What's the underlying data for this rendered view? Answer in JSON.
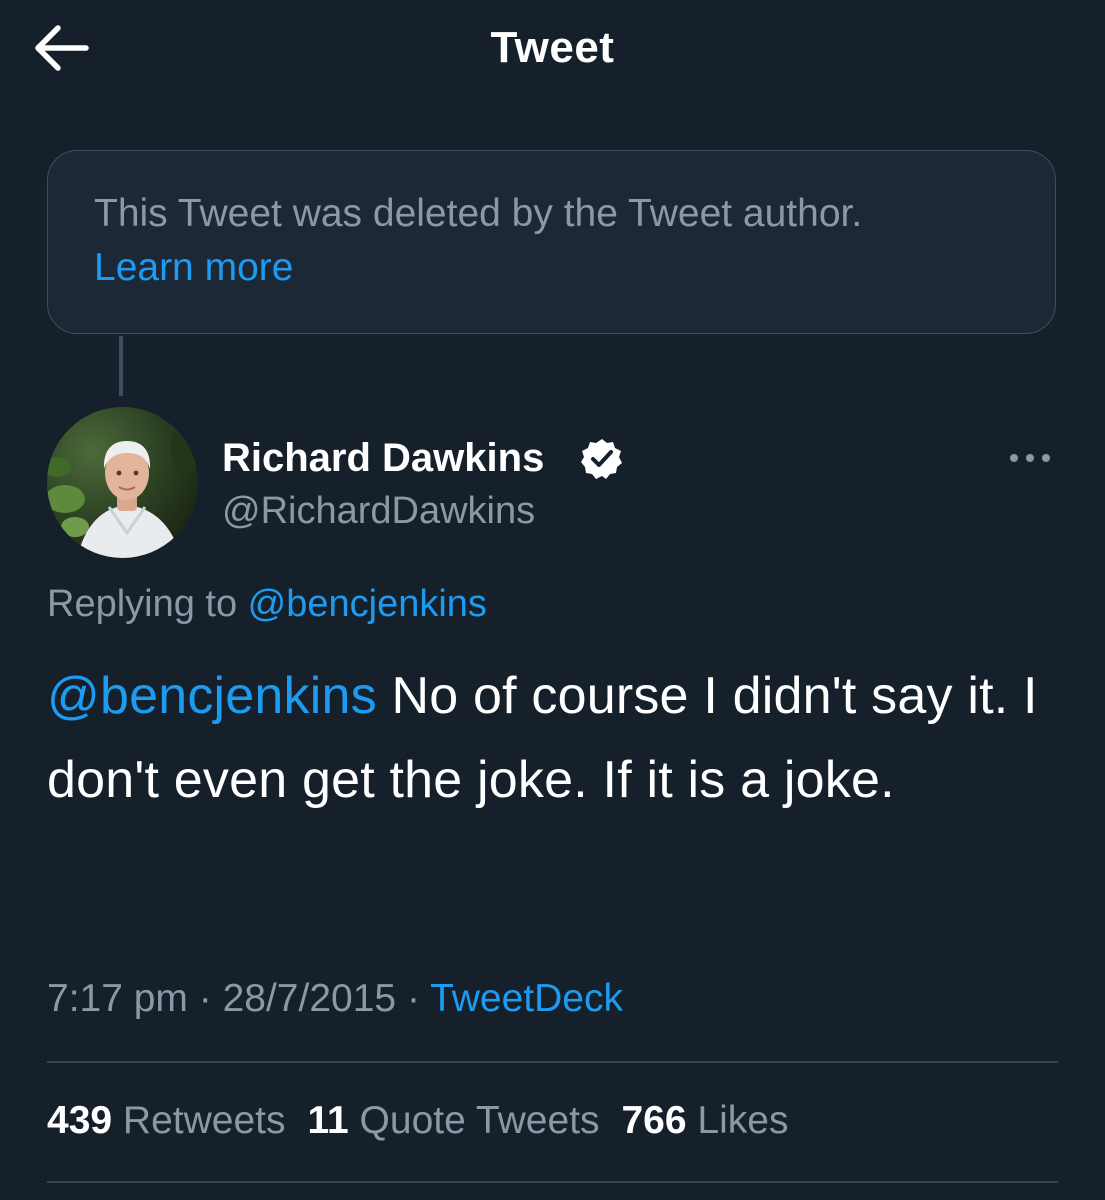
{
  "header": {
    "title": "Tweet",
    "back_icon": "arrow-left-icon"
  },
  "deleted_notice": {
    "text": "This Tweet was deleted by the Tweet author.",
    "link_label": "Learn more"
  },
  "author": {
    "display_name": "Richard Dawkins",
    "handle": "@RichardDawkins",
    "verified_icon": "verified-badge-icon",
    "more_icon": "more-horizontal-icon"
  },
  "reply_context": {
    "prefix": "Replying to ",
    "handle": "@bencjenkins"
  },
  "tweet": {
    "mention": "@bencjenkins",
    "body": " No of course I didn't say it. I don't even get the joke. If it is a joke."
  },
  "meta": {
    "time": "7:17 pm",
    "separator": " · ",
    "date": "28/7/2015",
    "client": "TweetDeck"
  },
  "stats": {
    "retweets_count": "439",
    "retweets_label": " Retweets",
    "quotes_count": "11",
    "quotes_label": " Quote Tweets",
    "likes_count": "766",
    "likes_label": " Likes"
  },
  "colors": {
    "background": "#15202b",
    "accent": "#1d9bf0",
    "secondary_text": "#8b98a5",
    "border": "#38444d"
  }
}
